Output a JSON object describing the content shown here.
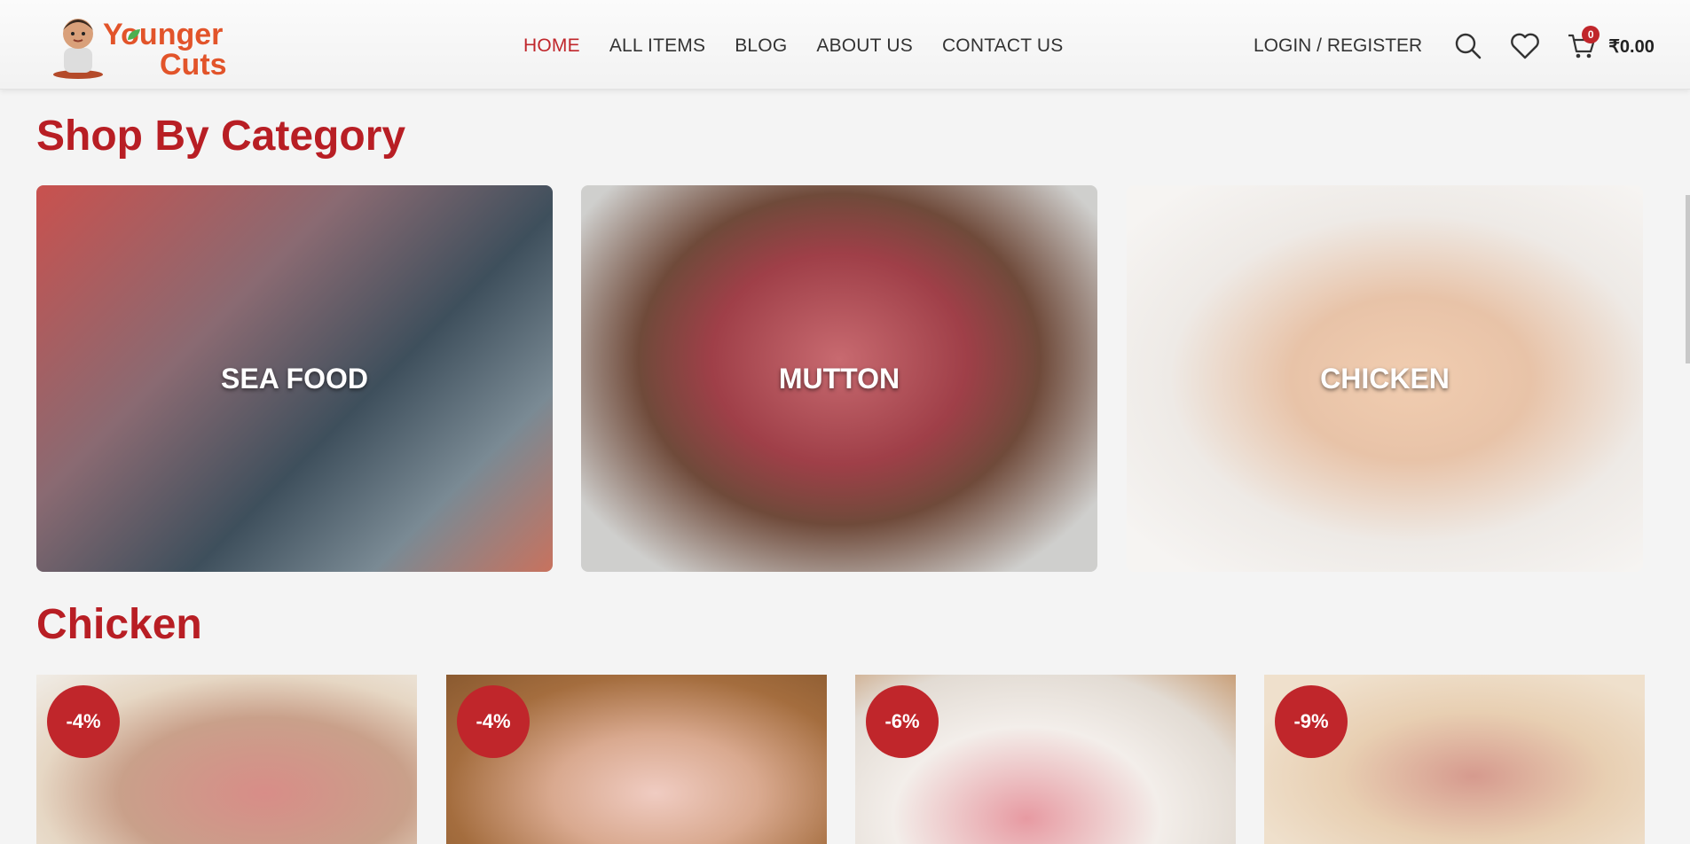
{
  "brand": {
    "line1": "Younger",
    "line2": "Cuts"
  },
  "nav": [
    {
      "label": "HOME",
      "active": true
    },
    {
      "label": "ALL ITEMS",
      "active": false
    },
    {
      "label": "BLOG",
      "active": false
    },
    {
      "label": "ABOUT US",
      "active": false
    },
    {
      "label": "CONTACT US",
      "active": false
    }
  ],
  "header_tools": {
    "login_label": "LOGIN / REGISTER",
    "cart_count": "0",
    "cart_total": "₹0.00"
  },
  "categories_section": {
    "title": "Shop By Category",
    "items": [
      {
        "label": "SEA FOOD"
      },
      {
        "label": "MUTTON"
      },
      {
        "label": "CHICKEN"
      }
    ]
  },
  "chicken_section": {
    "title": "Chicken",
    "products": [
      {
        "discount": "-4%"
      },
      {
        "discount": "-4%"
      },
      {
        "discount": "-6%"
      },
      {
        "discount": "-9%"
      }
    ]
  },
  "colors": {
    "accent": "#c0262b",
    "title": "#b81e24",
    "logo": "#e2542a"
  }
}
